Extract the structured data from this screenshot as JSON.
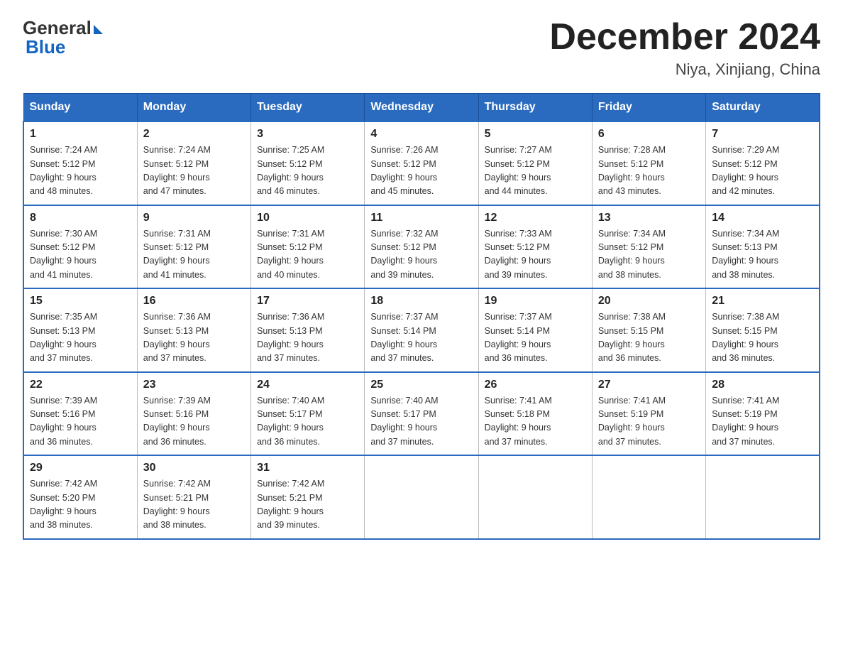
{
  "header": {
    "logo_text_general": "General",
    "logo_text_blue": "Blue",
    "title": "December 2024",
    "subtitle": "Niya, Xinjiang, China"
  },
  "days_of_week": [
    "Sunday",
    "Monday",
    "Tuesday",
    "Wednesday",
    "Thursday",
    "Friday",
    "Saturday"
  ],
  "weeks": [
    [
      {
        "day": "1",
        "sunrise": "7:24 AM",
        "sunset": "5:12 PM",
        "daylight": "9 hours and 48 minutes."
      },
      {
        "day": "2",
        "sunrise": "7:24 AM",
        "sunset": "5:12 PM",
        "daylight": "9 hours and 47 minutes."
      },
      {
        "day": "3",
        "sunrise": "7:25 AM",
        "sunset": "5:12 PM",
        "daylight": "9 hours and 46 minutes."
      },
      {
        "day": "4",
        "sunrise": "7:26 AM",
        "sunset": "5:12 PM",
        "daylight": "9 hours and 45 minutes."
      },
      {
        "day": "5",
        "sunrise": "7:27 AM",
        "sunset": "5:12 PM",
        "daylight": "9 hours and 44 minutes."
      },
      {
        "day": "6",
        "sunrise": "7:28 AM",
        "sunset": "5:12 PM",
        "daylight": "9 hours and 43 minutes."
      },
      {
        "day": "7",
        "sunrise": "7:29 AM",
        "sunset": "5:12 PM",
        "daylight": "9 hours and 42 minutes."
      }
    ],
    [
      {
        "day": "8",
        "sunrise": "7:30 AM",
        "sunset": "5:12 PM",
        "daylight": "9 hours and 41 minutes."
      },
      {
        "day": "9",
        "sunrise": "7:31 AM",
        "sunset": "5:12 PM",
        "daylight": "9 hours and 41 minutes."
      },
      {
        "day": "10",
        "sunrise": "7:31 AM",
        "sunset": "5:12 PM",
        "daylight": "9 hours and 40 minutes."
      },
      {
        "day": "11",
        "sunrise": "7:32 AM",
        "sunset": "5:12 PM",
        "daylight": "9 hours and 39 minutes."
      },
      {
        "day": "12",
        "sunrise": "7:33 AM",
        "sunset": "5:12 PM",
        "daylight": "9 hours and 39 minutes."
      },
      {
        "day": "13",
        "sunrise": "7:34 AM",
        "sunset": "5:12 PM",
        "daylight": "9 hours and 38 minutes."
      },
      {
        "day": "14",
        "sunrise": "7:34 AM",
        "sunset": "5:13 PM",
        "daylight": "9 hours and 38 minutes."
      }
    ],
    [
      {
        "day": "15",
        "sunrise": "7:35 AM",
        "sunset": "5:13 PM",
        "daylight": "9 hours and 37 minutes."
      },
      {
        "day": "16",
        "sunrise": "7:36 AM",
        "sunset": "5:13 PM",
        "daylight": "9 hours and 37 minutes."
      },
      {
        "day": "17",
        "sunrise": "7:36 AM",
        "sunset": "5:13 PM",
        "daylight": "9 hours and 37 minutes."
      },
      {
        "day": "18",
        "sunrise": "7:37 AM",
        "sunset": "5:14 PM",
        "daylight": "9 hours and 37 minutes."
      },
      {
        "day": "19",
        "sunrise": "7:37 AM",
        "sunset": "5:14 PM",
        "daylight": "9 hours and 36 minutes."
      },
      {
        "day": "20",
        "sunrise": "7:38 AM",
        "sunset": "5:15 PM",
        "daylight": "9 hours and 36 minutes."
      },
      {
        "day": "21",
        "sunrise": "7:38 AM",
        "sunset": "5:15 PM",
        "daylight": "9 hours and 36 minutes."
      }
    ],
    [
      {
        "day": "22",
        "sunrise": "7:39 AM",
        "sunset": "5:16 PM",
        "daylight": "9 hours and 36 minutes."
      },
      {
        "day": "23",
        "sunrise": "7:39 AM",
        "sunset": "5:16 PM",
        "daylight": "9 hours and 36 minutes."
      },
      {
        "day": "24",
        "sunrise": "7:40 AM",
        "sunset": "5:17 PM",
        "daylight": "9 hours and 36 minutes."
      },
      {
        "day": "25",
        "sunrise": "7:40 AM",
        "sunset": "5:17 PM",
        "daylight": "9 hours and 37 minutes."
      },
      {
        "day": "26",
        "sunrise": "7:41 AM",
        "sunset": "5:18 PM",
        "daylight": "9 hours and 37 minutes."
      },
      {
        "day": "27",
        "sunrise": "7:41 AM",
        "sunset": "5:19 PM",
        "daylight": "9 hours and 37 minutes."
      },
      {
        "day": "28",
        "sunrise": "7:41 AM",
        "sunset": "5:19 PM",
        "daylight": "9 hours and 37 minutes."
      }
    ],
    [
      {
        "day": "29",
        "sunrise": "7:42 AM",
        "sunset": "5:20 PM",
        "daylight": "9 hours and 38 minutes."
      },
      {
        "day": "30",
        "sunrise": "7:42 AM",
        "sunset": "5:21 PM",
        "daylight": "9 hours and 38 minutes."
      },
      {
        "day": "31",
        "sunrise": "7:42 AM",
        "sunset": "5:21 PM",
        "daylight": "9 hours and 39 minutes."
      },
      null,
      null,
      null,
      null
    ]
  ],
  "labels": {
    "sunrise": "Sunrise:",
    "sunset": "Sunset:",
    "daylight": "Daylight:"
  }
}
